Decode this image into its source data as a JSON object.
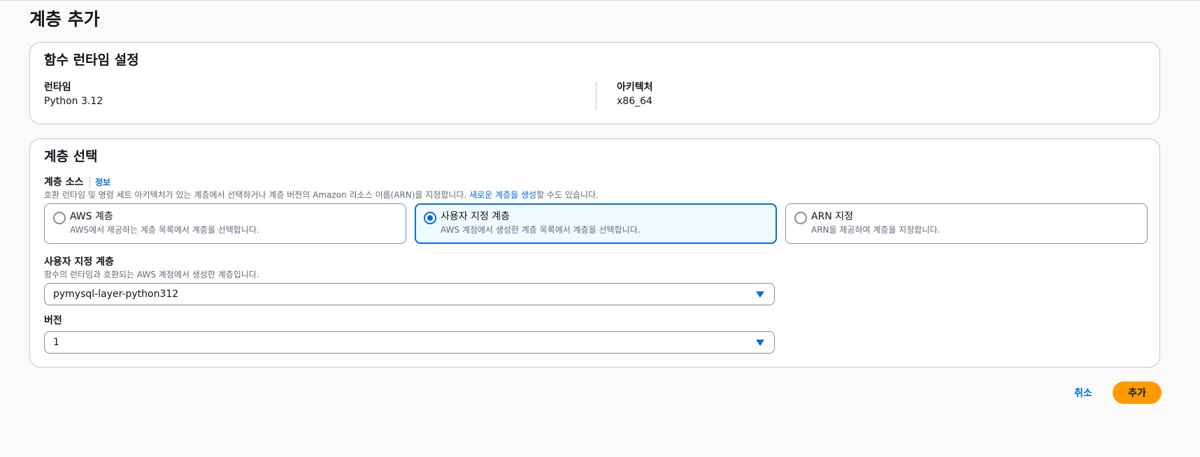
{
  "page": {
    "title": "계층 추가"
  },
  "runtime_settings": {
    "heading": "함수 런타임 설정",
    "runtime_label": "런타임",
    "runtime_value": "Python 3.12",
    "architecture_label": "아키텍처",
    "architecture_value": "x86_64"
  },
  "layer_selection": {
    "heading": "계층 선택",
    "source_label": "계층 소스",
    "info_link": "정보",
    "source_desc_before": "호환 런타임 및 명령 세트 아키텍처가 있는 계층에서 선택하거나 계층 버전의 Amazon 리소스 이름(ARN)을 지정합니다.",
    "source_desc_link": "새로운 계층을 생성",
    "source_desc_after": "할 수도 있습니다.",
    "options": [
      {
        "title": "AWS 계층",
        "desc": "AWS에서 제공하는 계층 목록에서 계층을 선택합니다.",
        "selected": false
      },
      {
        "title": "사용자 지정 계층",
        "desc": "AWS 계정에서 생성한 계층 목록에서 계층을 선택합니다.",
        "selected": true
      },
      {
        "title": "ARN 지정",
        "desc": "ARN을 제공하여 계층을 지정합니다.",
        "selected": false
      }
    ],
    "custom_layer_label": "사용자 지정 계층",
    "custom_layer_desc": "함수의 런타임과 호환되는 AWS 계정에서 생성한 계층입니다.",
    "custom_layer_value": "pymysql-layer-python312",
    "version_label": "버전",
    "version_value": "1"
  },
  "actions": {
    "cancel_label": "취소",
    "add_label": "추가"
  },
  "colors": {
    "accent": "#006ce0",
    "primary_button": "#ff9900",
    "selected_tile_bg": "#f0fbff"
  }
}
